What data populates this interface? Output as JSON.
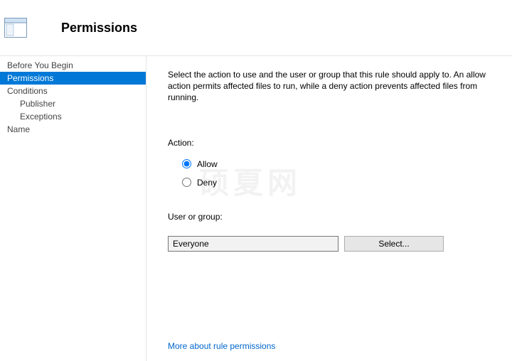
{
  "header": {
    "title": "Permissions"
  },
  "sidebar": {
    "items": [
      {
        "label": "Before You Begin",
        "indent": false,
        "selected": false
      },
      {
        "label": "Permissions",
        "indent": false,
        "selected": true
      },
      {
        "label": "Conditions",
        "indent": false,
        "selected": false
      },
      {
        "label": "Publisher",
        "indent": true,
        "selected": false
      },
      {
        "label": "Exceptions",
        "indent": true,
        "selected": false
      },
      {
        "label": "Name",
        "indent": false,
        "selected": false
      }
    ]
  },
  "main": {
    "description": "Select the action to use and the user or group that this rule should apply to. An allow action permits affected files to run, while a deny action prevents affected files from running.",
    "action": {
      "label": "Action:",
      "options": [
        {
          "label": "Allow",
          "value": "allow",
          "checked": true
        },
        {
          "label": "Deny",
          "value": "deny",
          "checked": false
        }
      ]
    },
    "user_group": {
      "label": "User or group:",
      "value": "Everyone",
      "select_button": "Select..."
    },
    "more_link": "More about rule permissions"
  },
  "watermark": "硕夏网"
}
